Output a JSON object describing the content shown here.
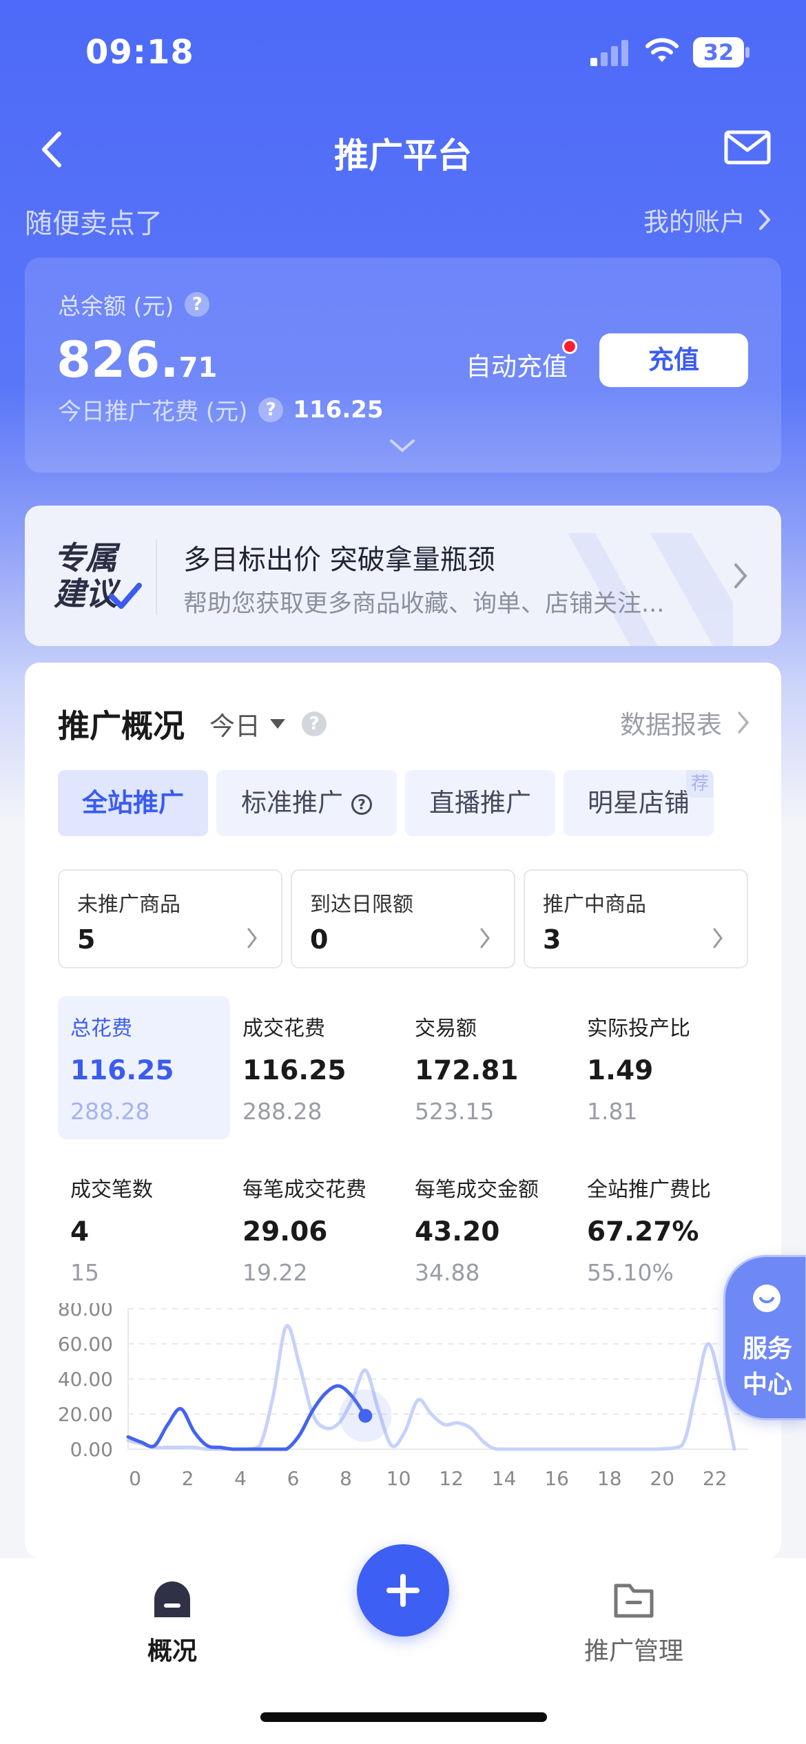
{
  "status_bar": {
    "time": "09:18",
    "battery": "32"
  },
  "nav": {
    "title": "推广平台"
  },
  "shop": {
    "name": "随便卖点了",
    "account_link": "我的账户"
  },
  "balance": {
    "label": "总余额 (元)",
    "amount_int": "826.",
    "amount_dec": "71",
    "today_label": "今日推广花费 (元)",
    "today_value": "116.25",
    "auto_recharge": "自动充值",
    "recharge_button": "充值"
  },
  "suggestion": {
    "badge_line1": "专属",
    "badge_line2": "建议",
    "headline": "多目标出价 突破拿量瓶颈",
    "description": "帮助您获取更多商品收藏、询单、店铺关注..."
  },
  "overview": {
    "title": "推广概况",
    "period": "今日",
    "report_link": "数据报表",
    "tabs": [
      {
        "label": "全站推广",
        "active": true
      },
      {
        "label": "标准推广",
        "active": false
      },
      {
        "label": "直播推广",
        "active": false
      },
      {
        "label": "明星店铺",
        "active": false,
        "badge": "荐"
      }
    ],
    "stat_boxes": [
      {
        "title": "未推广商品",
        "value": "5"
      },
      {
        "title": "到达日限额",
        "value": "0"
      },
      {
        "title": "推广中商品",
        "value": "3"
      }
    ],
    "metrics": [
      {
        "title": "总花费",
        "value": "116.25",
        "compare": "288.28",
        "active": true
      },
      {
        "title": "成交花费",
        "value": "116.25",
        "compare": "288.28"
      },
      {
        "title": "交易额",
        "value": "172.81",
        "compare": "523.15"
      },
      {
        "title": "实际投产比",
        "value": "1.49",
        "compare": "1.81"
      },
      {
        "title": "成交笔数",
        "value": "4",
        "compare": "15"
      },
      {
        "title": "每笔成交花费",
        "value": "29.06",
        "compare": "19.22"
      },
      {
        "title": "每笔成交金额",
        "value": "43.20",
        "compare": "34.88"
      },
      {
        "title": "全站推广费比",
        "value": "67.27%",
        "compare": "55.10%"
      }
    ]
  },
  "service": {
    "line1": "服务",
    "line2": "中心"
  },
  "tabbar": {
    "overview_label": "概况",
    "manage_label": "推广管理"
  },
  "colors": {
    "primary": "#3e5ff4",
    "today_line": "#4463ee",
    "compare_line": "#c6d2fb"
  },
  "chart_data": {
    "type": "line",
    "x_ticks": [
      "0",
      "2",
      "4",
      "6",
      "8",
      "10",
      "12",
      "14",
      "16",
      "18",
      "20",
      "22"
    ],
    "y_ticks": [
      "0.00",
      "20.00",
      "40.00",
      "60.00",
      "80.00"
    ],
    "ylim": [
      0,
      80
    ],
    "xlim": [
      0,
      23
    ],
    "series": [
      {
        "x": [
          0,
          0.5,
          1,
          1.5,
          2,
          2.5,
          3,
          3.5,
          4,
          4.5,
          5,
          5.5,
          6,
          6.5,
          7,
          7.5,
          8,
          8.5,
          9,
          9.5,
          10,
          10.5,
          11,
          11.5,
          12,
          12.5,
          13,
          13.5,
          14,
          15,
          16,
          17,
          18,
          19,
          20,
          21,
          21.5,
          22,
          22.5,
          23
        ],
        "y": [
          5,
          3,
          1,
          1,
          1,
          1,
          0,
          0,
          0,
          0,
          2,
          30,
          70,
          48,
          20,
          12,
          15,
          28,
          45,
          22,
          2,
          10,
          28,
          20,
          14,
          15,
          12,
          4,
          0,
          0,
          0,
          0,
          0,
          0,
          0,
          2,
          30,
          60,
          35,
          0
        ]
      },
      {
        "x": [
          0,
          0.5,
          1,
          1.5,
          2,
          2.5,
          3,
          3.5,
          4,
          4.5,
          5,
          5.5,
          6,
          6.5,
          7,
          7.5,
          8,
          8.5,
          9
        ],
        "y": [
          7,
          4,
          2,
          14,
          23,
          10,
          2,
          1,
          0,
          0,
          0,
          0,
          0,
          8,
          22,
          32,
          36,
          30,
          19
        ]
      }
    ]
  }
}
